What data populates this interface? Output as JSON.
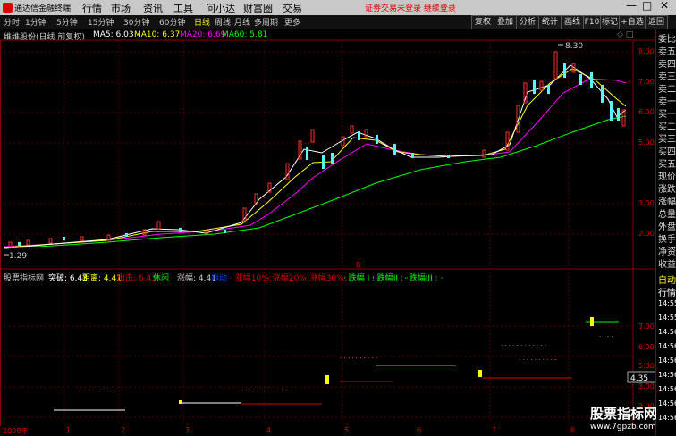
{
  "menubar": {
    "app_name": "通达信金融终端",
    "menus": [
      "行情",
      "市场",
      "资讯",
      "工具",
      "问小达",
      "财富圈",
      "交易"
    ],
    "alert": "证劵交易未登录 继续登录",
    "window_buttons": [
      "—",
      "□",
      "✕"
    ]
  },
  "toolbar": {
    "periods": [
      "分时",
      "1分钟",
      "5分钟",
      "15分钟",
      "30分钟",
      "60分钟",
      "日线",
      "周线",
      "月线",
      "多周期",
      "更多"
    ],
    "active_period": "日线",
    "buttons": [
      "复权",
      "叠加",
      "分析",
      "统计",
      "画线",
      "F10",
      "标记",
      "+自选",
      "返回"
    ]
  },
  "main_chart": {
    "stock_title": "维维股份(日线 前复权)",
    "ma5": "MA5: 6.03",
    "ma10": "MA10: 6.37",
    "ma20": "MA20: 6.69",
    "ma60": "MA60: 5.81",
    "high_label": "8.30",
    "low_label": "1.29",
    "price_ticks": [
      "8.00",
      "7.00",
      "6.00",
      "5.00",
      "3.00",
      "2.00"
    ],
    "colors": {
      "ma5": "#ffffff",
      "ma10": "#ffff00",
      "ma20": "#ff00ff",
      "ma60": "#00ff00",
      "up": "#ff3030",
      "down": "#54fcfc"
    }
  },
  "indicator": {
    "name": "股票指标网",
    "tupo": "突破: 6.43",
    "juli": "距离: 4.41",
    "chuji": "出击: 6.43",
    "xiuxian": "休闲",
    "zhangfu": "涨幅: 4.41",
    "zidong": "自动",
    "zhang10": "· 涨幅10%: ·",
    "zhang20": "· 涨幅20%: ·",
    "zhang30": "· 涨幅30%: ·",
    "die1": "· 跌幅 I : ·",
    "die2": "· 跌幅II : ·",
    "die3": "· 跌幅III : ·",
    "ticks": [
      "7.00",
      "6.00",
      "5.00",
      "3.00",
      "2.00"
    ],
    "current_value": "4.35"
  },
  "xaxis": {
    "labels": [
      "2008年",
      "1",
      "2",
      "3",
      "4",
      "5",
      "6",
      "7",
      "8"
    ]
  },
  "right_panel": {
    "top": [
      "委比",
      "卖五",
      "卖四",
      "卖三",
      "卖二",
      "卖一",
      "买一",
      "买二",
      "买三",
      "买四",
      "买五",
      "现价",
      "涨跌",
      "涨幅",
      "总量",
      "外盘",
      "换手",
      "净资",
      "收益"
    ],
    "bottom_header": [
      "自动",
      "行情"
    ],
    "times": [
      "14:55",
      "14:55",
      "14:56",
      "14:56",
      "14:56",
      "14:56",
      "14:56",
      "14:56",
      "14:56"
    ]
  },
  "watermark": {
    "line1": "股票指标网",
    "line2": "www.7gpzb.com"
  }
}
